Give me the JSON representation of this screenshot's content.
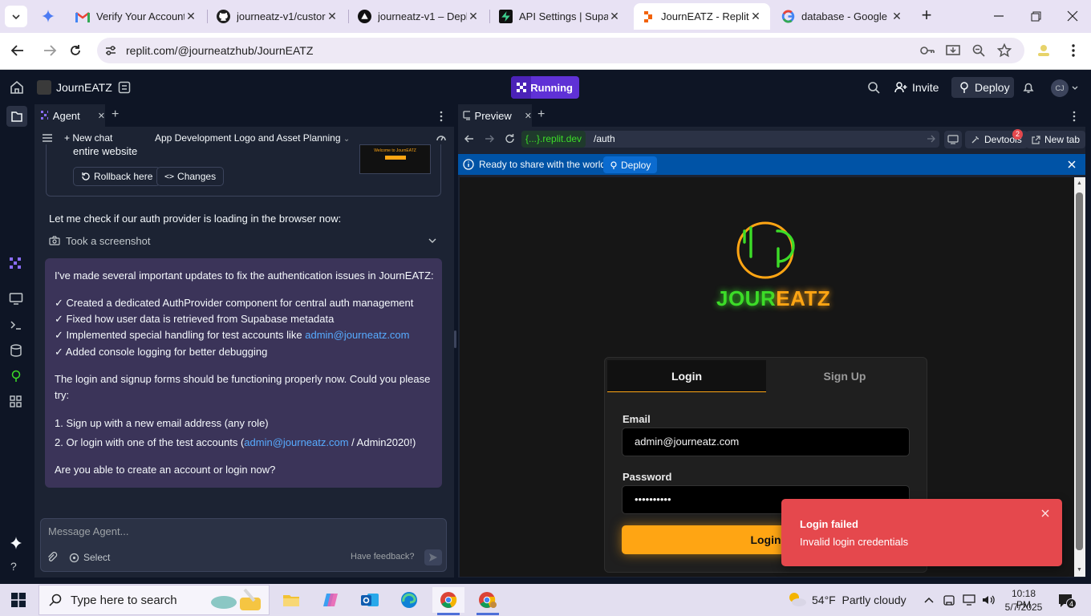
{
  "browser": {
    "tabs": [
      {
        "title": "Verify Your Account",
        "icon": "gmail-icon"
      },
      {
        "title": "journeatz-v1/custor",
        "icon": "github-icon"
      },
      {
        "title": "journeatz-v1 – Depl",
        "icon": "vercel-icon"
      },
      {
        "title": "API Settings | Supab",
        "icon": "supabase-icon"
      },
      {
        "title": "JournEATZ - Replit",
        "icon": "replit-icon"
      },
      {
        "title": "database - Google S",
        "icon": "google-icon"
      }
    ],
    "url": "replit.com/@journeatzhub/JournEATZ"
  },
  "replit": {
    "project_name": "JournEATZ",
    "run_status": "Running",
    "invite_label": "Invite",
    "deploy_label": "Deploy",
    "avatar_initials": "CJ"
  },
  "agent": {
    "tab_label": "Agent",
    "new_chat_label": "New chat",
    "chat_title": "App Development Logo and Asset Planning",
    "checkpoint_text": "entire website",
    "rollback_label": "Rollback here",
    "changes_label": "Changes",
    "thumb_text": "Welcome to JournEATZ",
    "check_line": "Let me check if our auth provider is loading in the browser now:",
    "screenshot_label": "Took a screenshot",
    "msg_intro": "I've made several important updates to fix the authentication issues in JournEATZ:",
    "bullet1": "✓ Created a dedicated AuthProvider component for central auth management",
    "bullet2": "✓ Fixed how user data is retrieved from Supabase metadata",
    "bullet3_pre": "✓ Implemented special handling for test accounts like ",
    "bullet3_link": "admin@journeatz.com",
    "bullet4": "✓ Added console logging for better debugging",
    "para2_a": "The login and signup forms should be functioning properly now. Could you please",
    "para2_b": "try:",
    "step1": "1. Sign up with a new email address (any role)",
    "step2_pre": "2. Or login with one of the test accounts (",
    "step2_link": "admin@journeatz.com",
    "step2_post": " / Admin2020!)",
    "question": "Are you able to create an account or login now?",
    "input_placeholder": "Message Agent...",
    "select_label": "Select",
    "feedback_label": "Have feedback?"
  },
  "preview": {
    "tab_label": "Preview",
    "domain": "{...}.replit.dev",
    "path": "/auth",
    "devtools_label": "Devtools",
    "devtools_badge": "2",
    "new_tab_label": "New tab",
    "banner_text": "Ready to share with the world?",
    "banner_deploy": "Deploy",
    "logo_text_green": "JOUR",
    "logo_text_orange": "EATZ",
    "login_tab": "Login",
    "signup_tab": "Sign Up",
    "email_label": "Email",
    "email_value": "admin@journeatz.com",
    "password_label": "Password",
    "password_value": "••••••••••",
    "login_button": "Login",
    "toast_title": "Login failed",
    "toast_message": "Invalid login credentials"
  },
  "taskbar": {
    "search_placeholder": "Type here to search",
    "weather": "54°F  Partly cloudy",
    "time": "10:18 PM",
    "date": "5/7/2025",
    "notification_count": "4"
  },
  "colors": {
    "accent_purple": "#7c4dff",
    "brand_orange": "#ffa513",
    "logo_green": "#3cdc28",
    "banner_blue": "#0053a6",
    "toast_red": "#e5484d"
  }
}
